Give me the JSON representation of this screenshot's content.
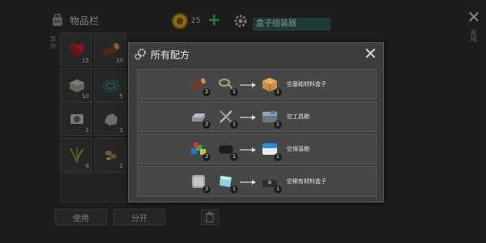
{
  "inventory": {
    "title": "物品栏",
    "side_tab_text": "其他",
    "slots": [
      {
        "name": "berries",
        "count": "15"
      },
      {
        "name": "wood-log",
        "count": "10"
      },
      {
        "name": "stone-block",
        "count": "10"
      },
      {
        "name": "cable-coil",
        "count": "5"
      },
      {
        "name": "gear-part",
        "count": "1"
      },
      {
        "name": "rock",
        "count": "2"
      },
      {
        "name": "fiber-plant",
        "count": "6"
      },
      {
        "name": "seeds",
        "count": "2"
      }
    ],
    "use_button": "使用",
    "split_button": "分开"
  },
  "currency": {
    "count": "25"
  },
  "assembler_tab": "盒子组装器",
  "close_label": "关闭",
  "modal": {
    "title": "所有配方",
    "recipes": [
      {
        "ingredients": [
          {
            "icon": "wood-log-icon",
            "count": "3"
          },
          {
            "icon": "rope-icon",
            "count": "1"
          }
        ],
        "result": {
          "icon": "wooden-crate-icon",
          "count": "1"
        },
        "label": "空基础材料盒子"
      },
      {
        "ingredients": [
          {
            "icon": "metal-ingot-icon",
            "count": "3"
          },
          {
            "icon": "tool-kit-icon",
            "count": "1"
          }
        ],
        "result": {
          "icon": "toolbox-icon",
          "count": "1"
        },
        "label": "空工具箱"
      },
      {
        "ingredients": [
          {
            "icon": "colored-cubes-icon",
            "count": "3"
          },
          {
            "icon": "black-cloth-icon",
            "count": "1"
          }
        ],
        "result": {
          "icon": "cooler-box-icon",
          "count": "1"
        },
        "label": "空保温箱"
      },
      {
        "ingredients": [
          {
            "icon": "steel-plate-icon",
            "count": "3"
          },
          {
            "icon": "glass-pane-icon",
            "count": "1"
          }
        ],
        "result": {
          "icon": "rare-crate-icon",
          "count": "1"
        },
        "label": "空稀有材料盒子"
      }
    ]
  },
  "colors": {
    "accent": "#2e5a55",
    "coin": "#d9a520",
    "plus": "#3fbf5a"
  }
}
